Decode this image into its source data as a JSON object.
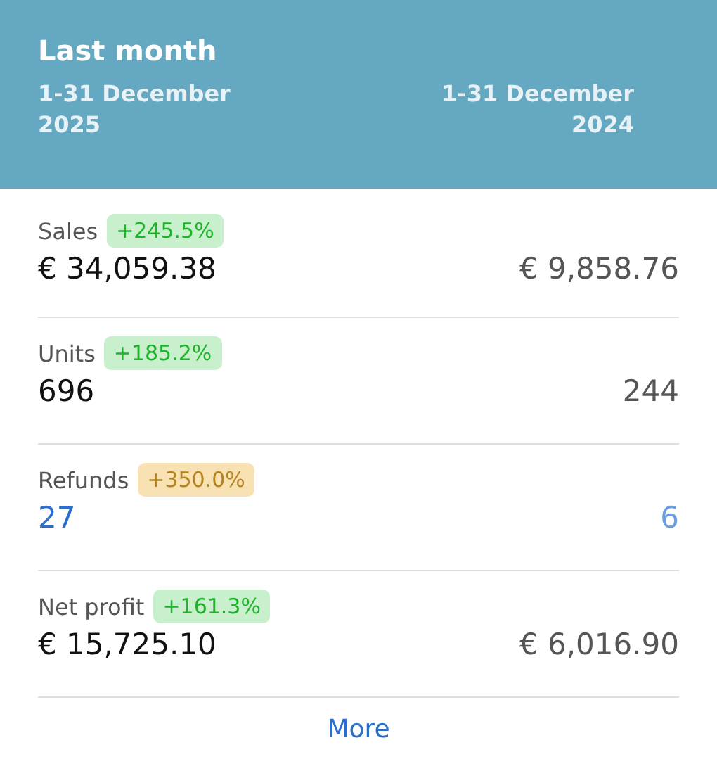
{
  "header": {
    "title": "Last month",
    "current_period": "1-31 December 2025",
    "previous_period": "1-31 December 2024"
  },
  "metrics": [
    {
      "label": "Sales",
      "change": "+245.5%",
      "color": "#c9f0cc",
      "kind": "plain",
      "current": "€ 34,059.38",
      "previous": "€ 9,858.76"
    },
    {
      "label": "Units",
      "change": "+185.2%",
      "color": "#c9f0cc",
      "kind": "plain",
      "current": "696",
      "previous": "244"
    },
    {
      "label": "Refunds",
      "change": "+350.0%",
      "color": "#f8e2b4",
      "kind": "link",
      "current": "27",
      "previous": "6"
    },
    {
      "label": "Net profit",
      "change": "+161.3%",
      "color": "#c9f0cc",
      "kind": "plain",
      "current": "€ 15,725.10",
      "previous": "€ 6,016.90"
    }
  ],
  "more_link": "More"
}
